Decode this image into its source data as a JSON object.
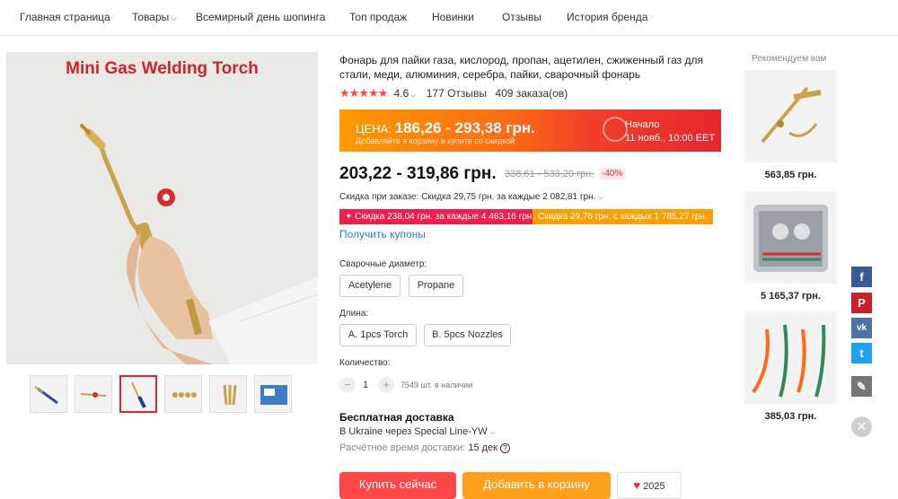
{
  "nav": {
    "items": [
      "Главная страница",
      "Товары",
      "Всемирный день шопинга",
      "Топ продаж",
      "Новинки",
      "Отзывы",
      "История бренда"
    ]
  },
  "gallery": {
    "image_title": "Mini Gas Welding Torch",
    "thumb_count": 6,
    "active_thumb": 3
  },
  "product": {
    "title": "Фонарь для пайки газа, кислород, пропан, ацетилен, сжиженный газ для стали, меди, алюминия, серебра, пайки, сварочный фонарь",
    "stars": "★★★★★",
    "rating": "4.6",
    "reviews": "177 Отзывы",
    "orders": "409 заказа(ов)"
  },
  "banner": {
    "price_label": "ЦЕНА: ",
    "price_value": "186,26 - 293,38 грн.",
    "sub": "Добавляйте в корзину и купите со скидкой",
    "start_label": "Начало",
    "start_date": "11 нояб., 10:00 EET",
    "gradient_from": "#ff9a00",
    "gradient_to": "#e8262f"
  },
  "pricing": {
    "current": "203,22 - 319,86 грн.",
    "old": "338,61 - 533,20 грн.",
    "discount": "-40%",
    "order_discount": "Скидка при заказе: Скидка 29,75 грн. за каждые 2 082,81 грн.",
    "coupon_red": "✦ Скидка 238,04 грн. за каждые 4 463,16 грн.",
    "coupon_orange": "Скидка 29,76 грн. с каждых 1 785,27 грн.",
    "get_coupons": "Получить купоны",
    "accent_red": "#f01e4b",
    "accent_orange": "#ffa000"
  },
  "options": {
    "diameter_label": "Сварочные диаметр:",
    "diameter": [
      "Acetylene",
      "Propane"
    ],
    "length_label": "Длина:",
    "length": [
      "A. 1pcs Torch",
      "B. 5pcs Nozzles"
    ],
    "qty_label": "Количество:",
    "qty": "1",
    "stock": "7549 шт. в наличии"
  },
  "shipping": {
    "title": "Бесплатная доставка",
    "to": "В Ukraine через Special Line-YW",
    "time_label": "Расчётное время доставки: ",
    "time_value": "15 дек"
  },
  "actions": {
    "buy": "Купить сейчас",
    "cart": "Добавить в корзину",
    "wish_count": "2025"
  },
  "recommend": {
    "title": "Рекомендуем вам",
    "prices": [
      "563,85 грн.",
      "5 165,37 грн.",
      "385,03 грн."
    ]
  },
  "social": {
    "facebook": "f",
    "pinterest": "P",
    "vk": "vk",
    "twitter": "t",
    "edit": "✎",
    "close": "✕",
    "colors": {
      "facebook": "#3b5998",
      "pinterest": "#cb2027",
      "vk": "#4c75a3",
      "twitter": "#1da1f2",
      "edit": "#777777"
    }
  }
}
